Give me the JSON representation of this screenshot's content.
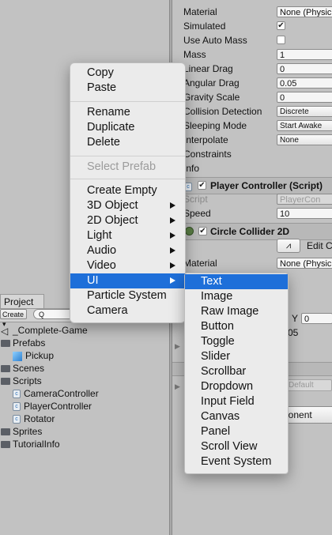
{
  "inspector": {
    "rigidbody_rows": [
      {
        "label": "Material",
        "value": "None (Physic",
        "kind": "field"
      },
      {
        "label": "Simulated",
        "value": "✔",
        "kind": "check"
      },
      {
        "label": "Use Auto Mass",
        "value": "",
        "kind": "check"
      },
      {
        "label": "Mass",
        "value": "1",
        "kind": "field"
      },
      {
        "label": "Linear Drag",
        "value": "0",
        "kind": "field"
      },
      {
        "label": "Angular Drag",
        "value": "0.05",
        "kind": "field"
      },
      {
        "label": "Gravity Scale",
        "value": "0",
        "kind": "field"
      },
      {
        "label": "Collision Detection",
        "value": "Discrete",
        "kind": "dropdown"
      },
      {
        "label": "Sleeping Mode",
        "value": "Start Awake",
        "kind": "dropdown"
      },
      {
        "label": "Interpolate",
        "value": "None",
        "kind": "dropdown"
      },
      {
        "label": "Constraints",
        "value": "",
        "kind": "none"
      },
      {
        "label": "Info",
        "value": "",
        "kind": "none"
      }
    ],
    "player_controller": {
      "title": "Player Controller (Script)",
      "script_label": "Script",
      "script_value": "PlayerCon",
      "speed_label": "Speed",
      "speed_value": "10"
    },
    "circle_collider": {
      "title": "Circle Collider 2D",
      "edit_label": "Edit C",
      "material_label": "Material",
      "material_value": "None (Physic"
    },
    "partial": {
      "y_label": "Y",
      "y_value": "0",
      "value_05": "05",
      "default_text": "Default",
      "add_component_fragment": "ponent"
    }
  },
  "project": {
    "tab_label": "Project",
    "create_label": "Create ▾",
    "search_placeholder": "Q",
    "tree": [
      {
        "label": "_Complete-Game",
        "icon": "unity-icon",
        "depth": 0
      },
      {
        "label": "Prefabs",
        "icon": "folder-icon",
        "depth": 0
      },
      {
        "label": "Pickup",
        "icon": "prefab-cube-icon",
        "depth": 1
      },
      {
        "label": "Scenes",
        "icon": "folder-icon",
        "depth": 0
      },
      {
        "label": "Scripts",
        "icon": "folder-icon",
        "depth": 0
      },
      {
        "label": "CameraController",
        "icon": "script-icon",
        "depth": 1
      },
      {
        "label": "PlayerController",
        "icon": "script-icon",
        "depth": 1
      },
      {
        "label": "Rotator",
        "icon": "script-icon",
        "depth": 1
      },
      {
        "label": "Sprites",
        "icon": "folder-icon",
        "depth": 0
      },
      {
        "label": "TutorialInfo",
        "icon": "folder-icon",
        "depth": 0
      }
    ]
  },
  "context_menu": {
    "group1": [
      "Copy",
      "Paste"
    ],
    "group2": [
      "Rename",
      "Duplicate",
      "Delete"
    ],
    "group3": [
      "Select Prefab"
    ],
    "group4": [
      {
        "label": "Create Empty",
        "submenu": false
      },
      {
        "label": "3D Object",
        "submenu": true
      },
      {
        "label": "2D Object",
        "submenu": true
      },
      {
        "label": "Light",
        "submenu": true
      },
      {
        "label": "Audio",
        "submenu": true
      },
      {
        "label": "Video",
        "submenu": true
      },
      {
        "label": "UI",
        "submenu": true
      },
      {
        "label": "Particle System",
        "submenu": false
      },
      {
        "label": "Camera",
        "submenu": false
      }
    ],
    "selected": "UI"
  },
  "ui_submenu": {
    "items": [
      "Text",
      "Image",
      "Raw Image",
      "Button",
      "Toggle",
      "Slider",
      "Scrollbar",
      "Dropdown",
      "Input Field",
      "Canvas",
      "Panel",
      "Scroll View",
      "Event System"
    ],
    "selected": "Text"
  },
  "colors": {
    "highlight": "#1e6fd9",
    "panel": "#c2c2c2",
    "menu": "#ebebeb"
  }
}
